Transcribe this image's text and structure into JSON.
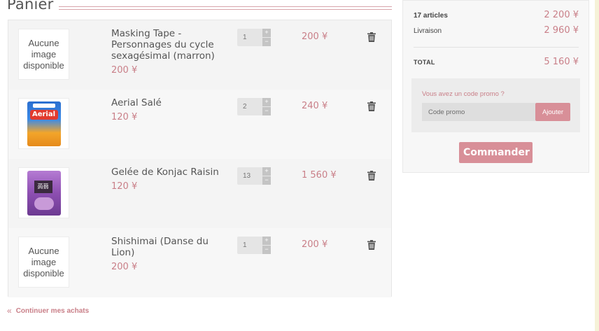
{
  "page": {
    "title": "Panier"
  },
  "cart": {
    "items": [
      {
        "name": "Masking Tape - Personnages du cycle sexagésimal (marron)",
        "unit_price": "200 ¥",
        "quantity": "1",
        "line_price": "200 ¥",
        "image": {
          "type": "placeholder",
          "text": "Aucune image disponible"
        }
      },
      {
        "name": "Aerial Salé",
        "unit_price": "120 ¥",
        "quantity": "2",
        "line_price": "240 ¥",
        "image": {
          "type": "product",
          "logo_text": "Aerial"
        }
      },
      {
        "name": "Gelée de Konjac Raisin",
        "unit_price": "120 ¥",
        "quantity": "13",
        "line_price": "1 560 ¥",
        "image": {
          "type": "product",
          "logo_text": "蒟蒻"
        }
      },
      {
        "name": "Shishimai (Danse du Lion)",
        "unit_price": "200 ¥",
        "quantity": "1",
        "line_price": "200 ¥",
        "image": {
          "type": "placeholder",
          "text": "Aucune image disponible"
        }
      }
    ],
    "qty_plus": "+",
    "qty_minus": "−"
  },
  "summary": {
    "articles_label": "17 articles",
    "articles_value": "2 200 ¥",
    "shipping_label": "Livraison",
    "shipping_value": "2 960 ¥",
    "total_label": "TOTAL",
    "total_value": "5 160 ¥",
    "promo": {
      "title": "Vous avez un code promo ?",
      "placeholder": "Code promo",
      "button": "Ajouter"
    },
    "checkout_button": "Commander"
  },
  "footer": {
    "continue_label": "Continuer mes achats",
    "continue_icon": "«"
  },
  "colors": {
    "accent": "#d88f98",
    "accent_text": "#c97f88"
  }
}
